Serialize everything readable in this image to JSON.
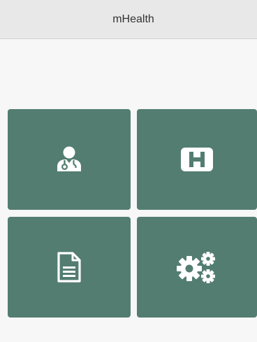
{
  "app": {
    "title": "mHealth"
  },
  "tiles": [
    {
      "icon": "doctor-icon"
    },
    {
      "icon": "hospital-icon"
    },
    {
      "icon": "document-icon"
    },
    {
      "icon": "gears-icon"
    }
  ],
  "colors": {
    "header_bg": "#e8e8e8",
    "page_bg": "#f7f7f7",
    "tile_bg": "#537d71",
    "icon_fg": "#ffffff"
  }
}
